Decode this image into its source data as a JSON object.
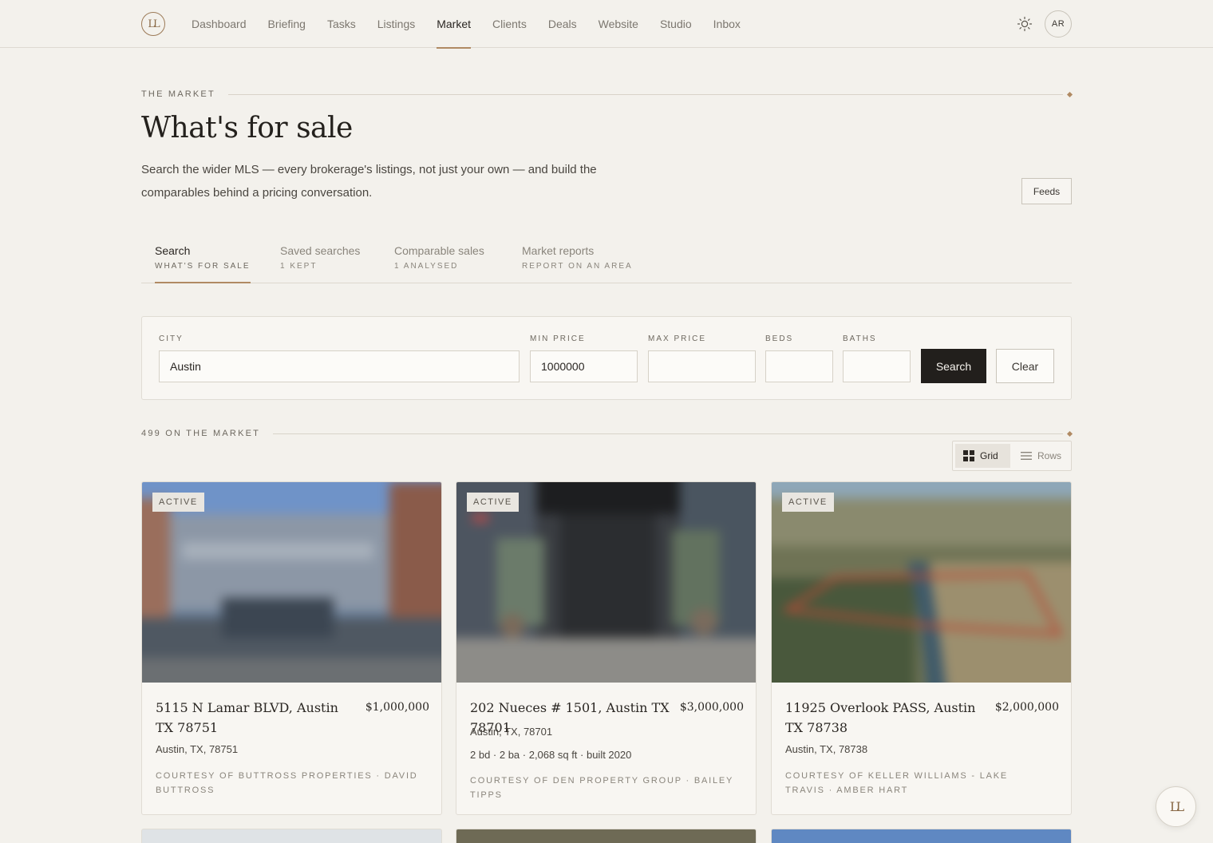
{
  "brand": {
    "logo_text": "LL"
  },
  "nav": {
    "items": [
      {
        "label": "Dashboard"
      },
      {
        "label": "Briefing"
      },
      {
        "label": "Tasks"
      },
      {
        "label": "Listings"
      },
      {
        "label": "Market",
        "active": true
      },
      {
        "label": "Clients"
      },
      {
        "label": "Deals"
      },
      {
        "label": "Website"
      },
      {
        "label": "Studio"
      },
      {
        "label": "Inbox"
      }
    ],
    "avatar_initials": "AR"
  },
  "header": {
    "eyebrow": "THE MARKET",
    "title": "What's for sale",
    "intro": "Search the wider MLS — every brokerage's listings, not just your own — and build the comparables behind a pricing conversation.",
    "feeds_label": "Feeds"
  },
  "tabs": [
    {
      "label": "Search",
      "sub": "WHAT'S FOR SALE",
      "active": true
    },
    {
      "label": "Saved searches",
      "sub": "1 KEPT"
    },
    {
      "label": "Comparable sales",
      "sub": "1 ANALYSED"
    },
    {
      "label": "Market reports",
      "sub": "REPORT ON AN AREA"
    }
  ],
  "search": {
    "city": {
      "label": "CITY",
      "value": "Austin"
    },
    "min_price": {
      "label": "MIN PRICE",
      "value": "1000000"
    },
    "max_price": {
      "label": "MAX PRICE",
      "value": ""
    },
    "beds": {
      "label": "BEDS",
      "value": ""
    },
    "baths": {
      "label": "BATHS",
      "value": ""
    },
    "search_label": "Search",
    "clear_label": "Clear"
  },
  "results": {
    "count_label": "499 ON THE MARKET",
    "view": {
      "grid_label": "Grid",
      "rows_label": "Rows",
      "selected": "Grid"
    }
  },
  "listings": [
    {
      "status": "ACTIVE",
      "address": "5115 N Lamar BLVD, Austin TX 78751",
      "price": "$1,000,000",
      "city": "Austin, TX, 78751",
      "specs": "",
      "courtesy": "COURTESY OF BUTTROSS PROPERTIES · DAVID BUTTROSS"
    },
    {
      "status": "ACTIVE",
      "address": "202 Nueces # 1501, Austin TX 78701",
      "price": "$3,000,000",
      "city": "Austin, TX, 78701",
      "specs": "2 bd · 2 ba · 2,068 sq ft · built 2020",
      "courtesy": "COURTESY OF DEN PROPERTY GROUP · BAILEY TIPPS"
    },
    {
      "status": "ACTIVE",
      "address": "11925 Overlook PASS, Austin TX 78738",
      "price": "$2,000,000",
      "city": "Austin, TX, 78738",
      "specs": "",
      "courtesy": "COURTESY OF KELLER WILLIAMS - LAKE TRAVIS · AMBER HART"
    }
  ],
  "colors": {
    "accent": "#b08a63",
    "background": "#f3f1ec",
    "primary_button": "#221f1c"
  }
}
